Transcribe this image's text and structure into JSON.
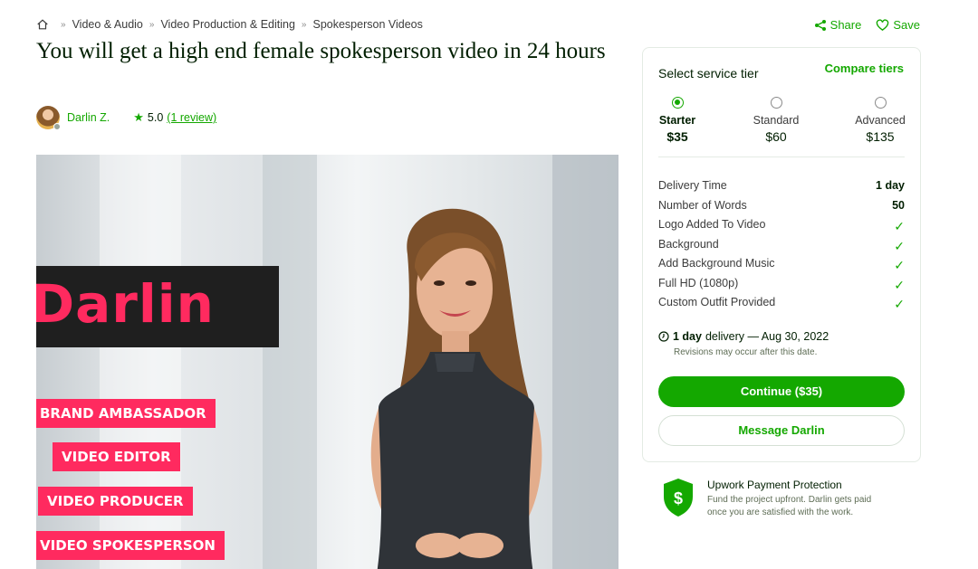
{
  "breadcrumb": {
    "items": [
      "Video & Audio",
      "Video Production & Editing",
      "Spokesperson Videos"
    ],
    "separator": "»"
  },
  "actions": {
    "share": "Share",
    "save": "Save"
  },
  "title": "You will get a high end female spokesperson video in 24 hours",
  "seller": {
    "name": "Darlin Z.",
    "rating": "5.0",
    "reviews": "(1 review)"
  },
  "hero": {
    "name": "Darlin",
    "tags": [
      "BRAND AMBASSADOR",
      "VIDEO EDITOR",
      "VIDEO PRODUCER",
      "VIDEO SPOKESPERSON"
    ]
  },
  "card": {
    "heading": "Select service tier",
    "compare": "Compare tiers",
    "tiers": [
      {
        "name": "Starter",
        "price": "$35",
        "selected": true
      },
      {
        "name": "Standard",
        "price": "$60",
        "selected": false
      },
      {
        "name": "Advanced",
        "price": "$135",
        "selected": false
      }
    ],
    "features": [
      {
        "label": "Delivery Time",
        "value": "1 day"
      },
      {
        "label": "Number of Words",
        "value": "50"
      },
      {
        "label": "Logo Added To Video",
        "value": "✓"
      },
      {
        "label": "Background",
        "value": "✓"
      },
      {
        "label": "Add Background Music",
        "value": "✓"
      },
      {
        "label": "Full HD (1080p)",
        "value": "✓"
      },
      {
        "label": "Custom Outfit Provided",
        "value": "✓"
      }
    ],
    "delivery_bold": "1 day",
    "delivery_rest": "delivery — Aug 30, 2022",
    "revisions_note": "Revisions may occur after this date.",
    "continue_label": "Continue ($35)",
    "message_label": "Message Darlin"
  },
  "protection": {
    "title": "Upwork Payment Protection",
    "body": "Fund the project upfront. Darlin gets paid once you are satisfied with the work.",
    "shield_symbol": "$"
  },
  "colors": {
    "accent": "#14a800",
    "tag": "#ff2a5f",
    "banner": "#1f1f1f"
  }
}
